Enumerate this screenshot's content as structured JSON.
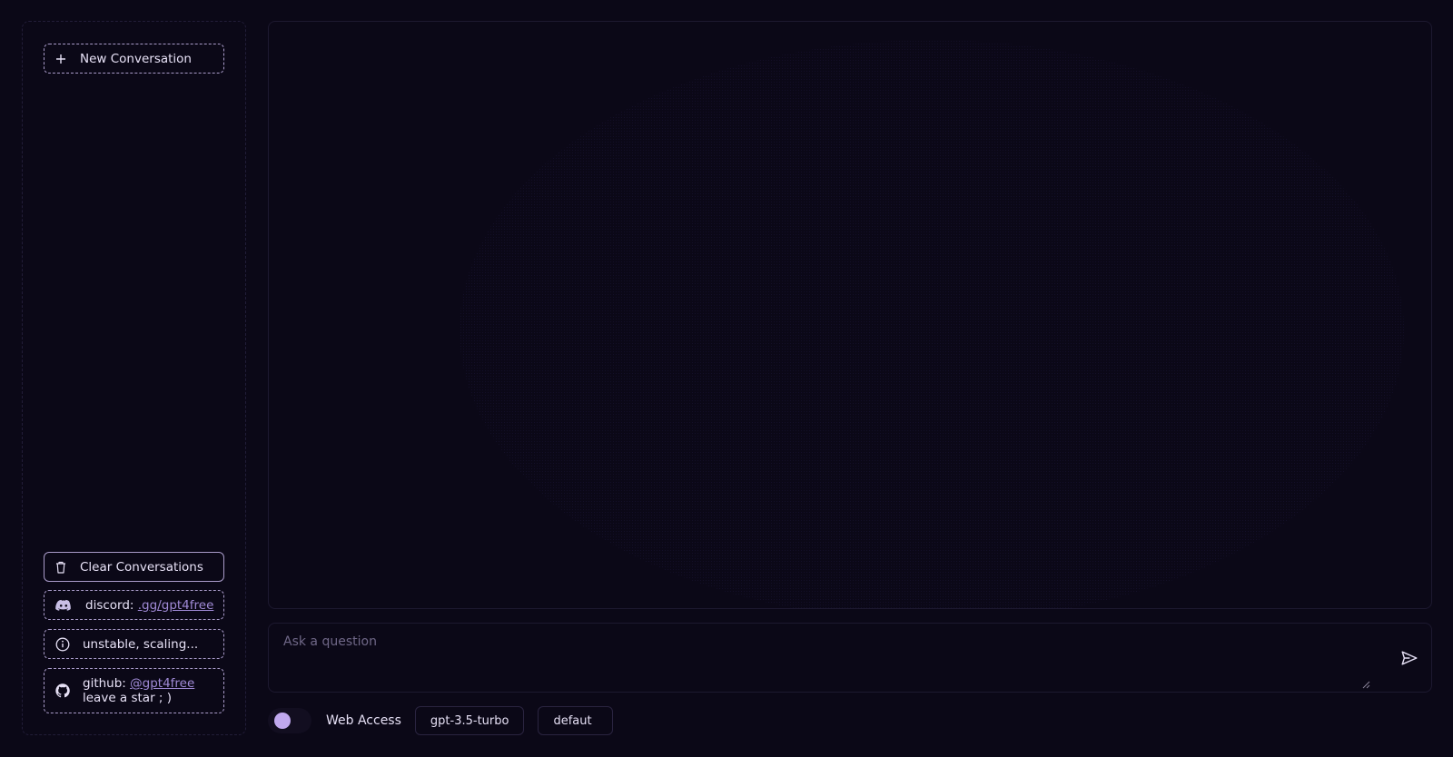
{
  "sidebar": {
    "new_conversation": "New Conversation",
    "clear_conversations": "Clear Conversations",
    "discord": {
      "label": "discord:",
      "link": ".gg/gpt4free"
    },
    "info": "unstable, scaling...",
    "github": {
      "label": "github:",
      "link": "@gpt4free",
      "line2": "leave a star ; )"
    }
  },
  "input": {
    "placeholder": "Ask a question",
    "value": ""
  },
  "bottom_bar": {
    "web_access_label": "Web Access",
    "web_access_enabled": false,
    "model": "gpt-3.5-turbo",
    "jailbreak": "defaut"
  },
  "colors": {
    "background": "#0b0817",
    "accent": "#c0a8ee",
    "link": "#a08ad6"
  },
  "icons": [
    "plus-icon",
    "trash-icon",
    "discord-icon",
    "info-icon",
    "github-icon",
    "send-icon"
  ]
}
